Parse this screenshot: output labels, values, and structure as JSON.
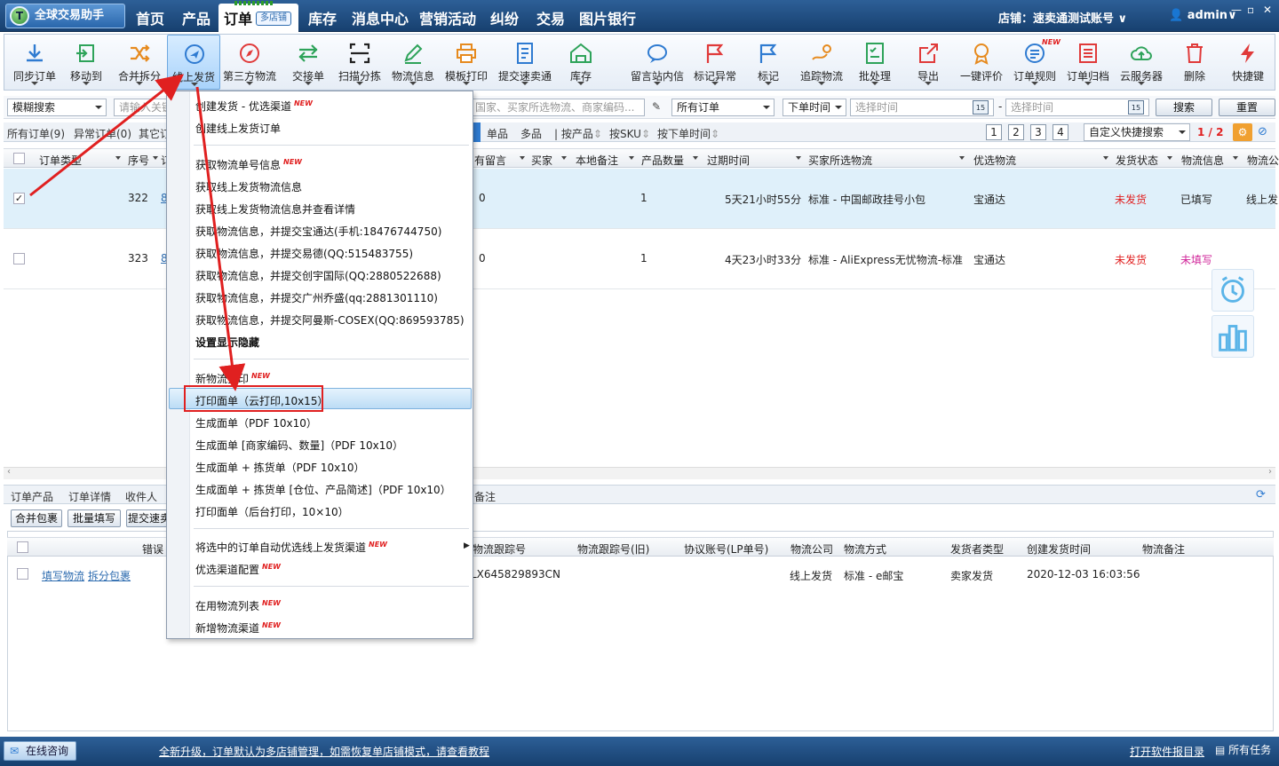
{
  "app": {
    "title": "全球交易助手"
  },
  "nav": {
    "items": [
      "首页",
      "产品",
      "订单",
      "库存",
      "消息中心",
      "营销活动",
      "纠纷",
      "交易",
      "图片银行"
    ],
    "active_badge": "多店铺",
    "shop": "店铺：速卖通测试账号",
    "user": "admin"
  },
  "toolbar": {
    "buttons": [
      "同步订单",
      "移动到",
      "合并拆分",
      "线上发货",
      "第三方物流",
      "交接单",
      "扫描分拣",
      "物流信息",
      "模板打印",
      "提交速卖通",
      "库存",
      "留言站内信",
      "标记异常",
      "标记",
      "追踪物流",
      "批处理",
      "导出",
      "一键评价",
      "订单规则",
      "订单归档",
      "云服务器",
      "删除",
      "快捷键"
    ],
    "new_tag": "NEW"
  },
  "filter": {
    "mode": "模糊搜索",
    "search_placeholder": "请输入关键",
    "search2_placeholder": "国家、买家所选物流、商家编码...",
    "order_scope": "所有订单",
    "time_type": "下单时间",
    "start_placeholder": "选择时间",
    "end_placeholder": "选择时间",
    "cal_day": "15",
    "dash": "-",
    "search_btn": "搜索",
    "reset_btn": "重置"
  },
  "tabs": {
    "all": "所有订单(9)",
    "abnormal": "异常订单(0)",
    "other": "其它订",
    "single": "单品",
    "multi": "多品",
    "by_product": "按产品",
    "by_sku": "按SKU",
    "by_time": "按下单时间",
    "pages": [
      "1",
      "2",
      "3",
      "4"
    ],
    "custom_search": "自定义快捷搜索",
    "page_info": "1 / 2"
  },
  "table": {
    "headers": [
      "订单类型",
      "序号",
      "订",
      "有留言",
      "买家",
      "本地备注",
      "产品数量",
      "过期时间",
      "买家所选物流",
      "优选物流",
      "发货状态",
      "物流信息",
      "物流公"
    ],
    "rows": [
      {
        "checked": "✓",
        "seq": "322",
        "link": "8",
        "msg": "0",
        "qty": "1",
        "expire": "5天21小时55分",
        "buyer_logistics": "标准 - 中国邮政挂号小包",
        "pref": "宝通达",
        "ship_status": "未发货",
        "logi_info": "已填写",
        "logi_co": "线上发"
      },
      {
        "checked": "",
        "seq": "323",
        "link": "8",
        "msg": "0",
        "qty": "1",
        "expire": "4天23小时33分",
        "buyer_logistics": "标准 - AliExpress无忧物流-标准",
        "pref": "宝通达",
        "ship_status": "未发货",
        "logi_info": "未填写",
        "logi_co": ""
      }
    ]
  },
  "bottom": {
    "tabs": [
      "订单产品",
      "订单详情",
      "收件人",
      "备注"
    ],
    "tools": [
      "合并包裹",
      "批量填写",
      "提交速卖"
    ],
    "headers": [
      "错误",
      "物流跟踪号",
      "物流跟踪号(旧)",
      "协议账号(LP单号)",
      "物流公司",
      "物流方式",
      "发货者类型",
      "创建发货时间",
      "物流备注"
    ],
    "row": {
      "fill": "填写物流",
      "split": "拆分包裹",
      "track": "LX645829893CN",
      "company": "线上发货",
      "method": "标准 - e邮宝",
      "sender": "卖家发货",
      "created": "2020-12-03 16:03:56"
    }
  },
  "menu": {
    "items": [
      "创建发货 - 优选渠道",
      "创建线上发货订单",
      "获取物流单号信息",
      "获取线上发货物流信息",
      "获取线上发货物流信息并查看详情",
      "获取物流信息，并提交宝通达(手机:18476744750)",
      "获取物流信息，并提交易德(QQ:515483755)",
      "获取物流信息，并提交创宇国际(QQ:2880522688)",
      "获取物流信息，并提交广州乔盛(qq:2881301110)",
      "获取物流信息，并提交阿曼斯-COSEX(QQ:869593785)",
      "设置显示隐藏",
      "新物流打印",
      "打印面单（云打印,10x15）",
      "生成面单（PDF 10x10）",
      "生成面单 [商家编码、数量]（PDF 10x10）",
      "生成面单 + 拣货单（PDF 10x10）",
      "生成面单 + 拣货单 [仓位、产品简述]（PDF 10x10）",
      "打印面单（后台打印，10×10）",
      "将选中的订单自动优选线上发货渠道",
      "优选渠道配置",
      "在用物流列表",
      "新增物流渠道"
    ]
  },
  "status": {
    "consult": "在线咨询",
    "notice": "全新升级，订单默认为多店铺管理，如需恢复单店铺模式，请查看教程",
    "open_log": "打开软件报目录",
    "tasks": "所有任务"
  },
  "colors": {
    "accent": "#2d5f97",
    "highlight_red": "#e02020",
    "selected_row": "#dff0fa"
  }
}
